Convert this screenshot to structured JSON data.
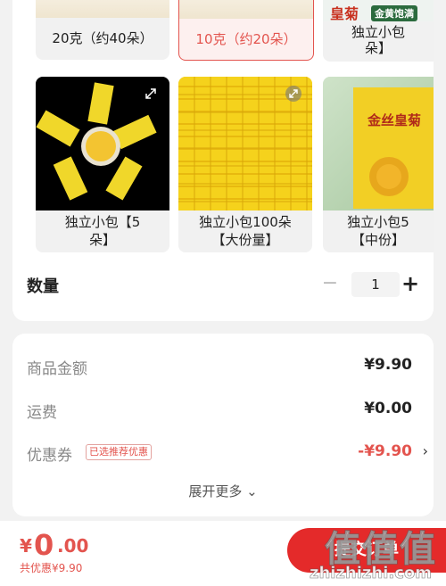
{
  "variants_row1": [
    {
      "label": "20克（约40朵）",
      "selected": false
    },
    {
      "label": "10克（约20朵）",
      "selected": true
    },
    {
      "label_line1": "独立小包",
      "label_line2": "朵】",
      "badge_title": "皇菊",
      "badge_sub": "金黄饱满"
    }
  ],
  "variants_row2": [
    {
      "label_line1": "独立小包【5",
      "label_line2": "朵】"
    },
    {
      "label_line1": "独立小包100朵",
      "label_line2": "【大份量】"
    },
    {
      "label_line1": "独立小包5",
      "label_line2": "【中份】",
      "pack_text": "金丝皇菊"
    }
  ],
  "quantity": {
    "label": "数量",
    "minus": "−",
    "value": "1",
    "plus": "+"
  },
  "summary": {
    "goods_label": "商品金额",
    "goods_value": "¥9.90",
    "shipping_label": "运费",
    "shipping_value": "¥0.00",
    "coupon_label": "优惠券",
    "coupon_tag": "已选推荐优惠",
    "coupon_value": "-¥9.90",
    "expand_more": "展开更多 ⌄"
  },
  "bottom": {
    "price_symbol": "¥",
    "price_int": "0",
    "price_dec": ".00",
    "saved_text": "共优惠¥9.90",
    "submit_label": "提交订单",
    "watermark_glyphs": "值值值",
    "watermark_url": "zhizhizhi.com"
  },
  "colors": {
    "accent": "#e3544e",
    "submit": "#e42a2a",
    "flower_yellow": "#f5d21c"
  }
}
